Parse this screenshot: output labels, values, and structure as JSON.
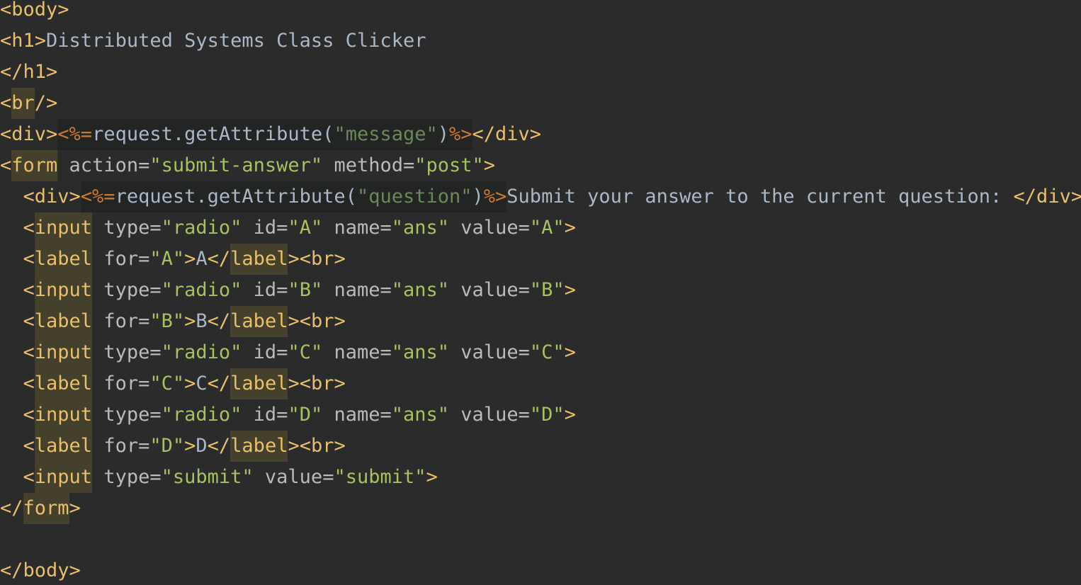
{
  "editor": {
    "lines": [
      {
        "segments": [
          {
            "cls": "t",
            "text": "<body>"
          }
        ]
      },
      {
        "segments": [
          {
            "cls": "t",
            "text": "<h1>"
          },
          {
            "cls": "x",
            "text": "Distributed Systems Class Clicker"
          }
        ]
      },
      {
        "segments": [
          {
            "cls": "t",
            "text": "</h1>"
          }
        ]
      },
      {
        "segments": [
          {
            "cls": "t",
            "text": "<"
          },
          {
            "cls": "t hl",
            "text": "br"
          },
          {
            "cls": "t",
            "text": "/>"
          }
        ]
      },
      {
        "segments": [
          {
            "cls": "t",
            "text": "<div>"
          },
          {
            "cls": "j jb",
            "text": "<%="
          },
          {
            "cls": "x jb",
            "text": "request.getAttribute("
          },
          {
            "cls": "js jb",
            "text": "\"message\""
          },
          {
            "cls": "x jb",
            "text": ")"
          },
          {
            "cls": "j jb",
            "text": "%>"
          },
          {
            "cls": "t",
            "text": "</div>"
          }
        ]
      },
      {
        "segments": [
          {
            "cls": "t",
            "text": "<"
          },
          {
            "cls": "t hl",
            "text": "form"
          },
          {
            "cls": "a",
            "text": " action="
          },
          {
            "cls": "s",
            "text": "\"submit-answer\""
          },
          {
            "cls": "a",
            "text": " method="
          },
          {
            "cls": "s",
            "text": "\"post\""
          },
          {
            "cls": "t",
            "text": ">"
          }
        ]
      },
      {
        "segments": [
          {
            "cls": "x",
            "text": "  "
          },
          {
            "cls": "t",
            "text": "<div>"
          },
          {
            "cls": "j jb",
            "text": "<%="
          },
          {
            "cls": "x jb",
            "text": "request.getAttribute("
          },
          {
            "cls": "js jb",
            "text": "\"question\""
          },
          {
            "cls": "x jb",
            "text": ")"
          },
          {
            "cls": "j jb",
            "text": "%>"
          },
          {
            "cls": "x",
            "text": "Submit your answer to the current question: "
          },
          {
            "cls": "t",
            "text": "</div>"
          }
        ]
      },
      {
        "segments": [
          {
            "cls": "x",
            "text": "  "
          },
          {
            "cls": "t",
            "text": "<"
          },
          {
            "cls": "t hl",
            "text": "input"
          },
          {
            "cls": "a",
            "text": " type="
          },
          {
            "cls": "s",
            "text": "\"radio\""
          },
          {
            "cls": "a",
            "text": " id="
          },
          {
            "cls": "s",
            "text": "\"A\""
          },
          {
            "cls": "a",
            "text": " name="
          },
          {
            "cls": "s",
            "text": "\"ans\""
          },
          {
            "cls": "a",
            "text": " value="
          },
          {
            "cls": "s",
            "text": "\"A\""
          },
          {
            "cls": "t",
            "text": ">"
          }
        ]
      },
      {
        "segments": [
          {
            "cls": "x",
            "text": "  "
          },
          {
            "cls": "t",
            "text": "<"
          },
          {
            "cls": "t hl",
            "text": "label"
          },
          {
            "cls": "a",
            "text": " for="
          },
          {
            "cls": "s",
            "text": "\"A\""
          },
          {
            "cls": "t",
            "text": ">"
          },
          {
            "cls": "x",
            "text": "A"
          },
          {
            "cls": "t",
            "text": "</"
          },
          {
            "cls": "t hl",
            "text": "label"
          },
          {
            "cls": "t",
            "text": "><br>"
          }
        ]
      },
      {
        "segments": [
          {
            "cls": "x",
            "text": "  "
          },
          {
            "cls": "t",
            "text": "<"
          },
          {
            "cls": "t hl",
            "text": "input"
          },
          {
            "cls": "a",
            "text": " type="
          },
          {
            "cls": "s",
            "text": "\"radio\""
          },
          {
            "cls": "a",
            "text": " id="
          },
          {
            "cls": "s",
            "text": "\"B\""
          },
          {
            "cls": "a",
            "text": " name="
          },
          {
            "cls": "s",
            "text": "\"ans\""
          },
          {
            "cls": "a",
            "text": " value="
          },
          {
            "cls": "s",
            "text": "\"B\""
          },
          {
            "cls": "t",
            "text": ">"
          }
        ]
      },
      {
        "segments": [
          {
            "cls": "x",
            "text": "  "
          },
          {
            "cls": "t",
            "text": "<"
          },
          {
            "cls": "t hl",
            "text": "label"
          },
          {
            "cls": "a",
            "text": " for="
          },
          {
            "cls": "s",
            "text": "\"B\""
          },
          {
            "cls": "t",
            "text": ">"
          },
          {
            "cls": "x",
            "text": "B"
          },
          {
            "cls": "t",
            "text": "</"
          },
          {
            "cls": "t hl",
            "text": "label"
          },
          {
            "cls": "t",
            "text": "><br>"
          }
        ]
      },
      {
        "segments": [
          {
            "cls": "x",
            "text": "  "
          },
          {
            "cls": "t",
            "text": "<"
          },
          {
            "cls": "t hl",
            "text": "input"
          },
          {
            "cls": "a",
            "text": " type="
          },
          {
            "cls": "s",
            "text": "\"radio\""
          },
          {
            "cls": "a",
            "text": " id="
          },
          {
            "cls": "s",
            "text": "\"C\""
          },
          {
            "cls": "a",
            "text": " name="
          },
          {
            "cls": "s",
            "text": "\"ans\""
          },
          {
            "cls": "a",
            "text": " value="
          },
          {
            "cls": "s",
            "text": "\"C\""
          },
          {
            "cls": "t",
            "text": ">"
          }
        ]
      },
      {
        "segments": [
          {
            "cls": "x",
            "text": "  "
          },
          {
            "cls": "t",
            "text": "<"
          },
          {
            "cls": "t hl",
            "text": "label"
          },
          {
            "cls": "a",
            "text": " for="
          },
          {
            "cls": "s",
            "text": "\"C\""
          },
          {
            "cls": "t",
            "text": ">"
          },
          {
            "cls": "x",
            "text": "C"
          },
          {
            "cls": "t",
            "text": "</"
          },
          {
            "cls": "t hl",
            "text": "label"
          },
          {
            "cls": "t",
            "text": "><br>"
          }
        ]
      },
      {
        "segments": [
          {
            "cls": "x",
            "text": "  "
          },
          {
            "cls": "t",
            "text": "<"
          },
          {
            "cls": "t hl",
            "text": "input"
          },
          {
            "cls": "a",
            "text": " type="
          },
          {
            "cls": "s",
            "text": "\"radio\""
          },
          {
            "cls": "a",
            "text": " id="
          },
          {
            "cls": "s",
            "text": "\"D\""
          },
          {
            "cls": "a",
            "text": " name="
          },
          {
            "cls": "s",
            "text": "\"ans\""
          },
          {
            "cls": "a",
            "text": " value="
          },
          {
            "cls": "s",
            "text": "\"D\""
          },
          {
            "cls": "t",
            "text": ">"
          }
        ]
      },
      {
        "segments": [
          {
            "cls": "x",
            "text": "  "
          },
          {
            "cls": "t",
            "text": "<"
          },
          {
            "cls": "t hl",
            "text": "label"
          },
          {
            "cls": "a",
            "text": " for="
          },
          {
            "cls": "s",
            "text": "\"D\""
          },
          {
            "cls": "t",
            "text": ">"
          },
          {
            "cls": "x",
            "text": "D"
          },
          {
            "cls": "t",
            "text": "</"
          },
          {
            "cls": "t hl",
            "text": "label"
          },
          {
            "cls": "t",
            "text": "><br>"
          }
        ]
      },
      {
        "segments": [
          {
            "cls": "x",
            "text": "  "
          },
          {
            "cls": "t",
            "text": "<"
          },
          {
            "cls": "t hl",
            "text": "input"
          },
          {
            "cls": "a",
            "text": " type="
          },
          {
            "cls": "s",
            "text": "\"submit\""
          },
          {
            "cls": "a",
            "text": " value="
          },
          {
            "cls": "s",
            "text": "\"submit\""
          },
          {
            "cls": "t",
            "text": ">"
          }
        ]
      },
      {
        "segments": [
          {
            "cls": "t",
            "text": "</"
          },
          {
            "cls": "t hl",
            "text": "form"
          },
          {
            "cls": "t",
            "text": ">"
          }
        ]
      },
      {
        "segments": []
      },
      {
        "segments": [
          {
            "cls": "t",
            "text": "</body>"
          }
        ]
      }
    ]
  }
}
